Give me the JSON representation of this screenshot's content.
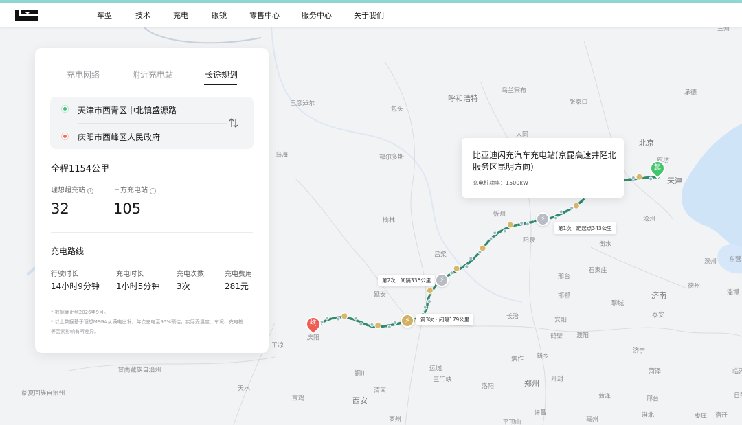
{
  "nav": {
    "logo": "lixiang-logo",
    "items": [
      "车型",
      "技术",
      "充电",
      "眼镜",
      "零售中心",
      "服务中心",
      "关于我们"
    ]
  },
  "panel": {
    "tabs": [
      {
        "label": "充电网络",
        "active": false
      },
      {
        "label": "附近充电站",
        "active": false
      },
      {
        "label": "长途规划",
        "active": true
      }
    ],
    "origin": "天津市西青区中北镇盛源路",
    "destination": "庆阳市西峰区人民政府",
    "total_distance": "全程1154公里",
    "stats": [
      {
        "label": "理想超充站",
        "value": "32"
      },
      {
        "label": "三方充电站",
        "value": "105"
      }
    ],
    "route_section_title": "充电路线",
    "metrics": [
      {
        "label": "行驶时长",
        "value": "14小时9分钟"
      },
      {
        "label": "充电时长",
        "value": "1小时5分钟"
      },
      {
        "label": "充电次数",
        "value": "3次"
      },
      {
        "label": "充电费用",
        "value": "281元"
      }
    ],
    "notes": [
      "* 数据截止到2026年9月。",
      "* 以上数据基于理想MEGA从满电出发，每次充电至95%预估，实际受温度、车况、充电桩",
      "等因素影响有所差异。"
    ]
  },
  "map": {
    "tooltip": {
      "title": "比亚迪闪充汽车充电站(京昆高速井陉北服务区昆明方向)",
      "power": "充电桩功率：1500kW"
    },
    "stops": [
      "第1次 · 距起点343公里",
      "第2次 · 间隔336公里",
      "第3次 · 间隔179公里"
    ],
    "start_marker": "起",
    "end_marker": "终",
    "cities": [
      "巴彦淖尔",
      "包头",
      "呼和浩特",
      "乌兰察布",
      "张家口",
      "承德",
      "北京",
      "廊坊",
      "天津",
      "大同",
      "乌海",
      "鄂尔多斯",
      "忻州",
      "阳泉",
      "衡水",
      "沧州",
      "榆林",
      "吕梁",
      "邢台",
      "德州",
      "滨州",
      "东营",
      "延安",
      "长治",
      "邯郸",
      "聊城",
      "济南",
      "淄博",
      "泰安",
      "安阳",
      "鹤壁",
      "濮阳",
      "庆阳",
      "平凉",
      "新乡",
      "焦作",
      "济宁",
      "铜川",
      "运城",
      "三门峡",
      "洛阳",
      "郑州",
      "开封",
      "菏泽",
      "甘南藏族自治州",
      "天水",
      "宝鸡",
      "西安",
      "渭南",
      "商州",
      "许昌",
      "亳州",
      "临沂",
      "日照",
      "淮北",
      "枣庄",
      "宿迁",
      "平顶山",
      "石家庄",
      "临夏回族自治州",
      "菏泽",
      "邢台",
      "兰州"
    ]
  }
}
